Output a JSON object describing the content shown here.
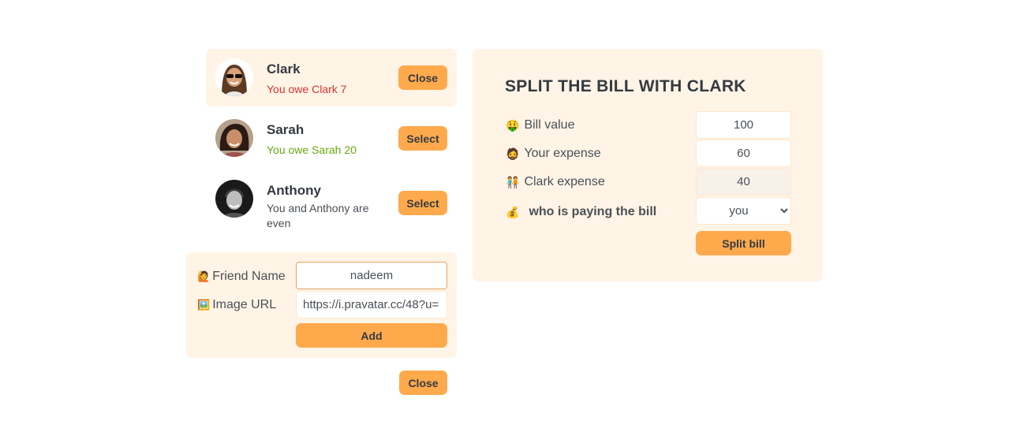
{
  "friends": [
    {
      "name": "Clark",
      "status": "You owe Clark 7",
      "status_tone": "red",
      "button": "Close",
      "selected": true
    },
    {
      "name": "Sarah",
      "status": "You owe Sarah 20",
      "status_tone": "green",
      "button": "Select",
      "selected": false
    },
    {
      "name": "Anthony",
      "status": "You and Anthony are even",
      "status_tone": "gray",
      "button": "Select",
      "selected": false
    }
  ],
  "add_form": {
    "name_label": "Friend Name",
    "name_icon": "🙋",
    "name_value": "nadeem",
    "image_label": "Image URL",
    "image_icon": "🖼️",
    "image_value": "https://i.pravatar.cc/48?u=",
    "add_button": "Add"
  },
  "close_button": "Close",
  "split": {
    "title": "SPLIT THE BILL WITH CLARK",
    "bill_label": "Bill value",
    "bill_icon": "🤑",
    "bill_value": "100",
    "your_label": "Your expense",
    "your_icon": "🧔",
    "your_value": "60",
    "friend_label": "Clark expense",
    "friend_icon": "🧑‍🤝‍🧑",
    "friend_value": "40",
    "payer_label": "who is paying the bill",
    "payer_icon": "💰",
    "payer_value": "you",
    "submit_button": "Split bill"
  },
  "colors": {
    "accent": "#ffa94d",
    "panel": "#fff4e6",
    "owe": "#e03131",
    "owed": "#66a80f"
  }
}
